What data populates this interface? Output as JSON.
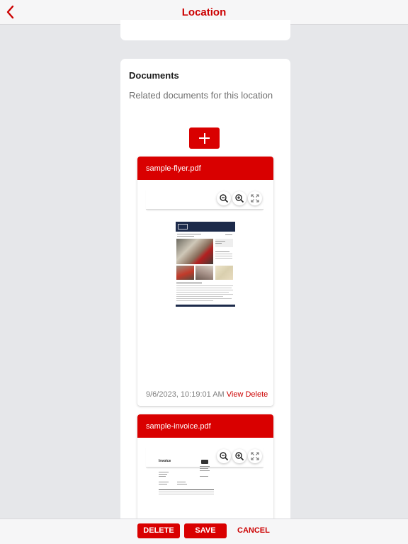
{
  "header": {
    "title": "Location"
  },
  "documents": {
    "title": "Documents",
    "subtitle": "Related documents for this location",
    "items": [
      {
        "name": "sample-flyer.pdf",
        "timestamp": "9/6/2023, 10:19:01 AM",
        "view_label": "View",
        "delete_label": "Delete"
      },
      {
        "name": "sample-invoice.pdf",
        "invoice_heading": "Invoice"
      }
    ]
  },
  "footer": {
    "delete_label": "DELETE",
    "save_label": "SAVE",
    "cancel_label": "CANCEL"
  },
  "colors": {
    "accent": "#d90000",
    "background": "#e6e7ea"
  },
  "icons": [
    "back-chevron-icon",
    "plus-icon",
    "zoom-out-icon",
    "zoom-in-icon",
    "fullscreen-icon"
  ]
}
